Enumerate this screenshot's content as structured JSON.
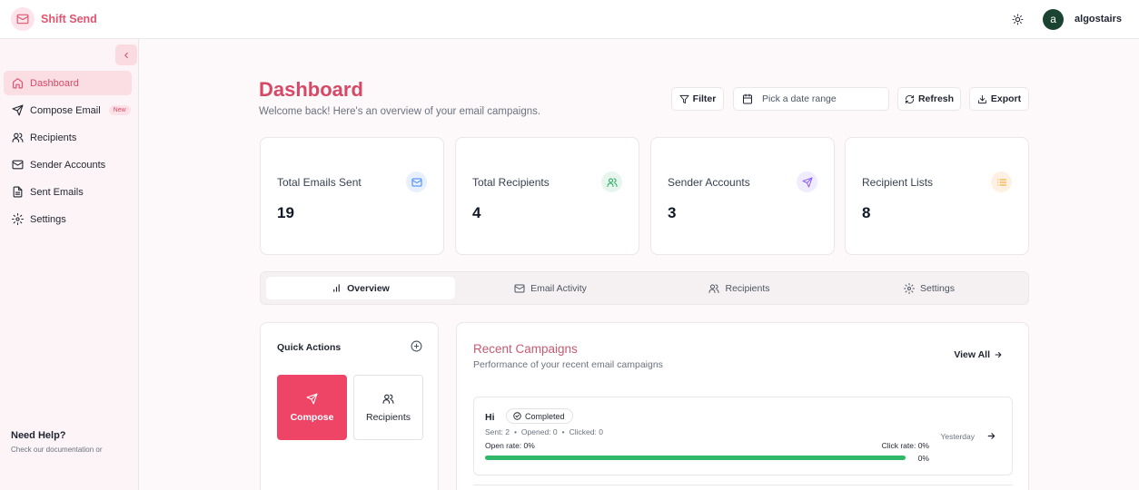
{
  "app": {
    "name": "Shift Send",
    "icon": "mail-icon"
  },
  "header": {
    "theme_icon": "sun-icon",
    "avatar_initial": "a",
    "username": "algostairs"
  },
  "sidebar": {
    "collapse_icon": "chevron-left-icon",
    "items": [
      {
        "label": "Dashboard",
        "icon": "home-icon",
        "active": true
      },
      {
        "label": "Compose Email",
        "icon": "send-icon",
        "badge": "New"
      },
      {
        "label": "Recipients",
        "icon": "users-icon"
      },
      {
        "label": "Sender Accounts",
        "icon": "mail-icon"
      },
      {
        "label": "Sent Emails",
        "icon": "file-text-icon"
      },
      {
        "label": "Settings",
        "icon": "gear-icon"
      }
    ],
    "help": {
      "title": "Need Help?",
      "text": "Check our documentation or"
    }
  },
  "page": {
    "title": "Dashboard",
    "subtitle": "Welcome back! Here's an overview of your email campaigns."
  },
  "toolbar": {
    "filter_label": "Filter",
    "date_placeholder": "Pick a date range",
    "refresh_label": "Refresh",
    "export_label": "Export"
  },
  "stats": [
    {
      "label": "Total Emails Sent",
      "value": "19",
      "icon": "mail-icon",
      "color": "#3b82f6",
      "bg": "#e8f0fe"
    },
    {
      "label": "Total Recipients",
      "value": "4",
      "icon": "users-icon",
      "color": "#22a35a",
      "bg": "#e6f6ec"
    },
    {
      "label": "Sender Accounts",
      "value": "3",
      "icon": "send-icon",
      "color": "#8b5cf6",
      "bg": "#f1ebfe"
    },
    {
      "label": "Recipient Lists",
      "value": "8",
      "icon": "list-icon",
      "color": "#f59e0b",
      "bg": "#fef1e4"
    }
  ],
  "tabs": [
    {
      "label": "Overview",
      "icon": "bar-chart-icon",
      "active": true
    },
    {
      "label": "Email Activity",
      "icon": "mail-icon"
    },
    {
      "label": "Recipients",
      "icon": "users-icon"
    },
    {
      "label": "Settings",
      "icon": "gear-icon"
    }
  ],
  "quick_actions": {
    "title": "Quick Actions",
    "compose_label": "Compose",
    "recipients_label": "Recipients"
  },
  "recent_campaigns": {
    "title": "Recent Campaigns",
    "subtitle": "Performance of your recent email campaigns",
    "view_all": "View All",
    "items": [
      {
        "name": "Hi",
        "status": "Completed",
        "sent": "Sent: 2",
        "opened": "Opened: 0",
        "clicked": "Clicked: 0",
        "open_rate": "Open rate: 0%",
        "click_rate": "Click rate: 0%",
        "progress_pct": "0%",
        "progress_fraction": 1,
        "date": "Yesterday"
      }
    ]
  },
  "colors": {
    "accent": "#e0556f",
    "compose_bg": "#ee4566",
    "progress": "#2eb867"
  }
}
